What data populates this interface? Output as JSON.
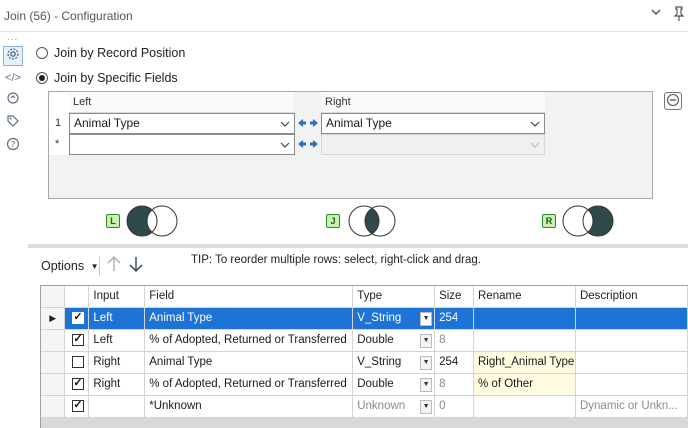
{
  "window": {
    "title": "Join (56) - Configuration",
    "collapse_icon": "chevron-down-icon",
    "pin_icon": "pin-icon"
  },
  "rail": {
    "dots": "...",
    "items": [
      {
        "icon": "gear-icon",
        "glyph": "⚙",
        "active": true
      },
      {
        "icon": "code-icon",
        "glyph": "</>"
      },
      {
        "icon": "refresh-icon",
        "glyph": "⟳"
      },
      {
        "icon": "tag-icon",
        "glyph": "⬗"
      },
      {
        "icon": "help-icon",
        "glyph": "?"
      }
    ]
  },
  "join_mode": {
    "options": [
      {
        "label": "Join by Record Position",
        "selected": false
      },
      {
        "label": "Join by Specific Fields",
        "selected": true
      }
    ]
  },
  "join_fields": {
    "left_header": "Left",
    "right_header": "Right",
    "rows": [
      {
        "num": "1",
        "left": "Animal Type",
        "right": "Animal Type"
      },
      {
        "num": "*",
        "left": "",
        "right": ""
      }
    ],
    "swap_glyph": "⇆"
  },
  "venn": {
    "badges": [
      "L",
      "J",
      "R"
    ]
  },
  "options_bar": {
    "options_label": "Options",
    "tip": "TIP: To reorder multiple rows: select, right-click and drag."
  },
  "grid": {
    "columns": [
      "",
      "",
      "Input",
      "Field",
      "Type",
      "Size",
      "Rename",
      "Description"
    ],
    "rows": [
      {
        "pointer": "▶",
        "checked": true,
        "input": "Left",
        "field": "Animal Type",
        "type": "V_String",
        "size": "254",
        "rename": "",
        "description": "",
        "selected": true
      },
      {
        "pointer": "",
        "checked": true,
        "input": "Left",
        "field": "% of Adopted, Returned or Transferred",
        "type": "Double",
        "size": "8",
        "rename": "",
        "description": ""
      },
      {
        "pointer": "",
        "checked": false,
        "input": "Right",
        "field": "Animal Type",
        "type": "V_String",
        "size": "254",
        "rename": "Right_Animal Type",
        "description": ""
      },
      {
        "pointer": "",
        "checked": true,
        "input": "Right",
        "field": "% of Adopted, Returned or Transferred",
        "type": "Double",
        "size": "8",
        "rename": "% of Other",
        "description": ""
      },
      {
        "pointer": "",
        "checked": true,
        "input": "",
        "field": "*Unknown",
        "type": "Unknown",
        "size": "0",
        "rename": "",
        "description": "Dynamic or Unkn..."
      }
    ]
  },
  "colors": {
    "selection": "#1e73d6",
    "rename_highlight": "#fffbe0",
    "venn_fill": "#2e4a4a",
    "badge_green": "#c8f0b0"
  }
}
